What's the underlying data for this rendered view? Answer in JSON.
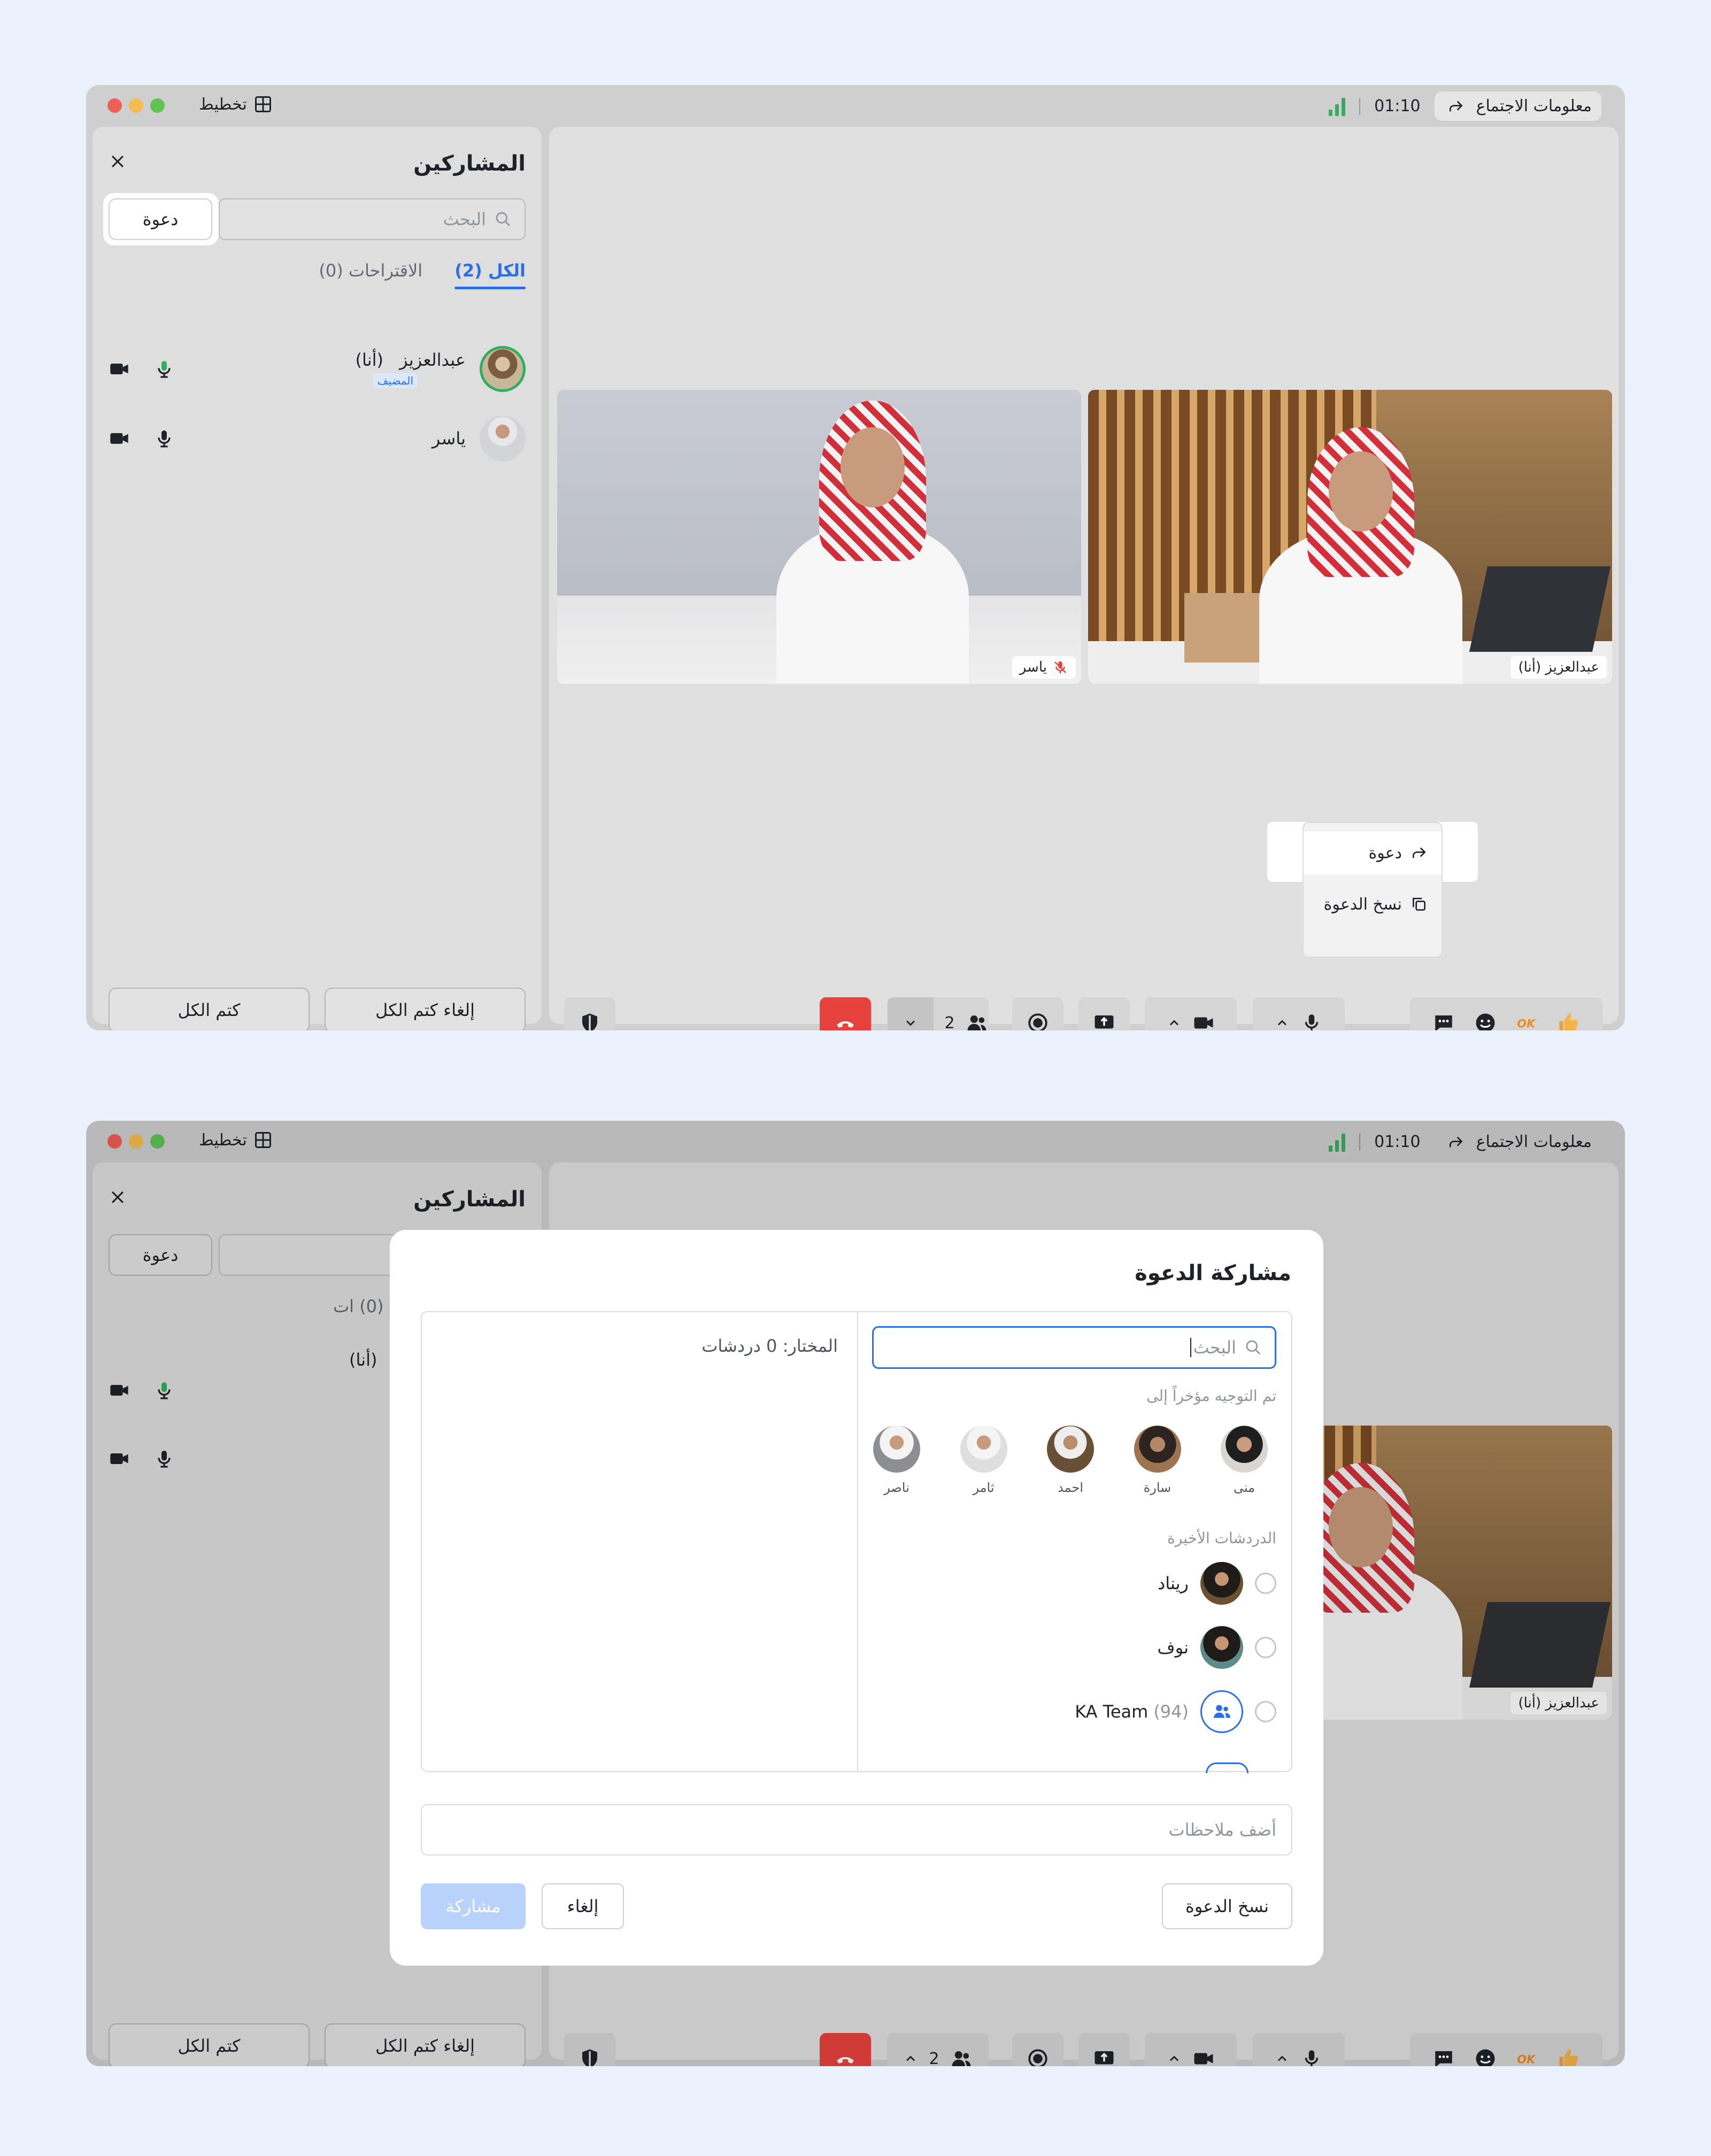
{
  "window": {
    "layout_label": "تخطيط",
    "timer": "01:10",
    "meeting_info_label": "معلومات الاجتماع"
  },
  "participants_panel": {
    "title": "المشاركين",
    "search_placeholder": "البحث",
    "invite_label": "دعوة",
    "tabs": {
      "all": "الكل (2)",
      "suggestions": "الاقتراحات (0)"
    },
    "participants": [
      {
        "name": "عبدالعزيز",
        "self_tag": "(أنا)",
        "host_badge": "المضيف",
        "mic": "mic-on",
        "camera": "camera-on"
      },
      {
        "name": "ياسر",
        "mic": "mic-on",
        "camera": "camera-on"
      }
    ],
    "unmute_all_label": "إلغاء كتم الكل",
    "mute_all_label": "كتم الكل",
    "suggestions_partial": "(0) ات"
  },
  "video_tiles": [
    {
      "name": "ياسر",
      "mic": "mic-off"
    },
    {
      "name": "عبدالعزيز (أنا)"
    }
  ],
  "invite_menu": {
    "items": [
      {
        "label": "دعوة",
        "icon": "share-icon"
      },
      {
        "label": "نسخ الدعوة",
        "icon": "copy-icon"
      }
    ]
  },
  "control_bar": {
    "participant_count": "2",
    "reactions": [
      "comment-icon",
      "smile-icon",
      "ok-icon",
      "thumbs-up-icon"
    ],
    "colors": {
      "hangup": "#e8423f",
      "accent": "#2b6fe6",
      "signal": "#30b05c"
    }
  },
  "share_modal": {
    "title": "مشاركة الدعوة",
    "search_placeholder": "البحث",
    "selected_label": "المختار: 0 دردشات",
    "recent_forward_label": "تم التوجيه مؤخراً إلى",
    "recent_contacts": [
      "منى",
      "سارة",
      "احمد",
      "ثامر",
      "ناصر"
    ],
    "recent_chats_label": "الدردشات الأخيرة",
    "chats": [
      {
        "name": "ريناد"
      },
      {
        "name": "نوف"
      },
      {
        "name": "KA Team",
        "count": "(94)"
      }
    ],
    "notes_placeholder": "أضف ملاحظات",
    "copy_invite_label": "نسخ الدعوة",
    "cancel_label": "إلغاء",
    "share_label": "مشاركة"
  }
}
